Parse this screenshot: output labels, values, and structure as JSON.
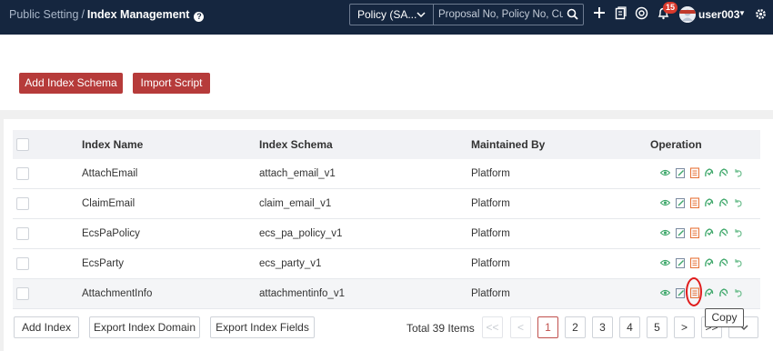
{
  "header": {
    "breadcrumb_root": "Public Setting",
    "breadcrumb_sep": "/",
    "breadcrumb_current": "Index Management",
    "help_glyph": "?",
    "policy_select": "Policy (SA...",
    "search_placeholder": "Proposal No, Policy No, Cust",
    "notification_count": "15",
    "user_name": "user003",
    "icons": [
      "search-icon",
      "plus-icon",
      "document-icon",
      "target-icon",
      "bell-icon",
      "gear-icon"
    ]
  },
  "actions": {
    "add_schema": "Add Index Schema",
    "import_script": "Import Script"
  },
  "table": {
    "columns": [
      "Index Name",
      "Index Schema",
      "Maintained By",
      "Operation"
    ],
    "rows": [
      {
        "name": "AttachEmail",
        "schema": "attach_email_v1",
        "maintained": "Platform"
      },
      {
        "name": "ClaimEmail",
        "schema": "claim_email_v1",
        "maintained": "Platform"
      },
      {
        "name": "EcsPaPolicy",
        "schema": "ecs_pa_policy_v1",
        "maintained": "Platform"
      },
      {
        "name": "EcsParty",
        "schema": "ecs_party_v1",
        "maintained": "Platform"
      },
      {
        "name": "AttachmentInfo",
        "schema": "attachmentinfo_v1",
        "maintained": "Platform"
      }
    ],
    "operation_icons": [
      "view-icon",
      "edit-icon",
      "copy-icon",
      "publish-icon",
      "unpublish-icon",
      "undo-icon"
    ]
  },
  "footer": {
    "add_index": "Add Index",
    "export_domain": "Export Index Domain",
    "export_fields": "Export Index Fields",
    "total": "Total 39 Items",
    "pages": [
      "1",
      "2",
      "3",
      "4",
      "5"
    ],
    "first": "<<",
    "prev": "<",
    "next": ">",
    "last": ">>",
    "tooltip": "Copy"
  },
  "colors": {
    "topbar": "#15263f",
    "primary_button": "#b63b3a",
    "op_green": "#3fa86b",
    "op_orange": "#e7743a",
    "annotation_circle": "#e01b1b"
  }
}
